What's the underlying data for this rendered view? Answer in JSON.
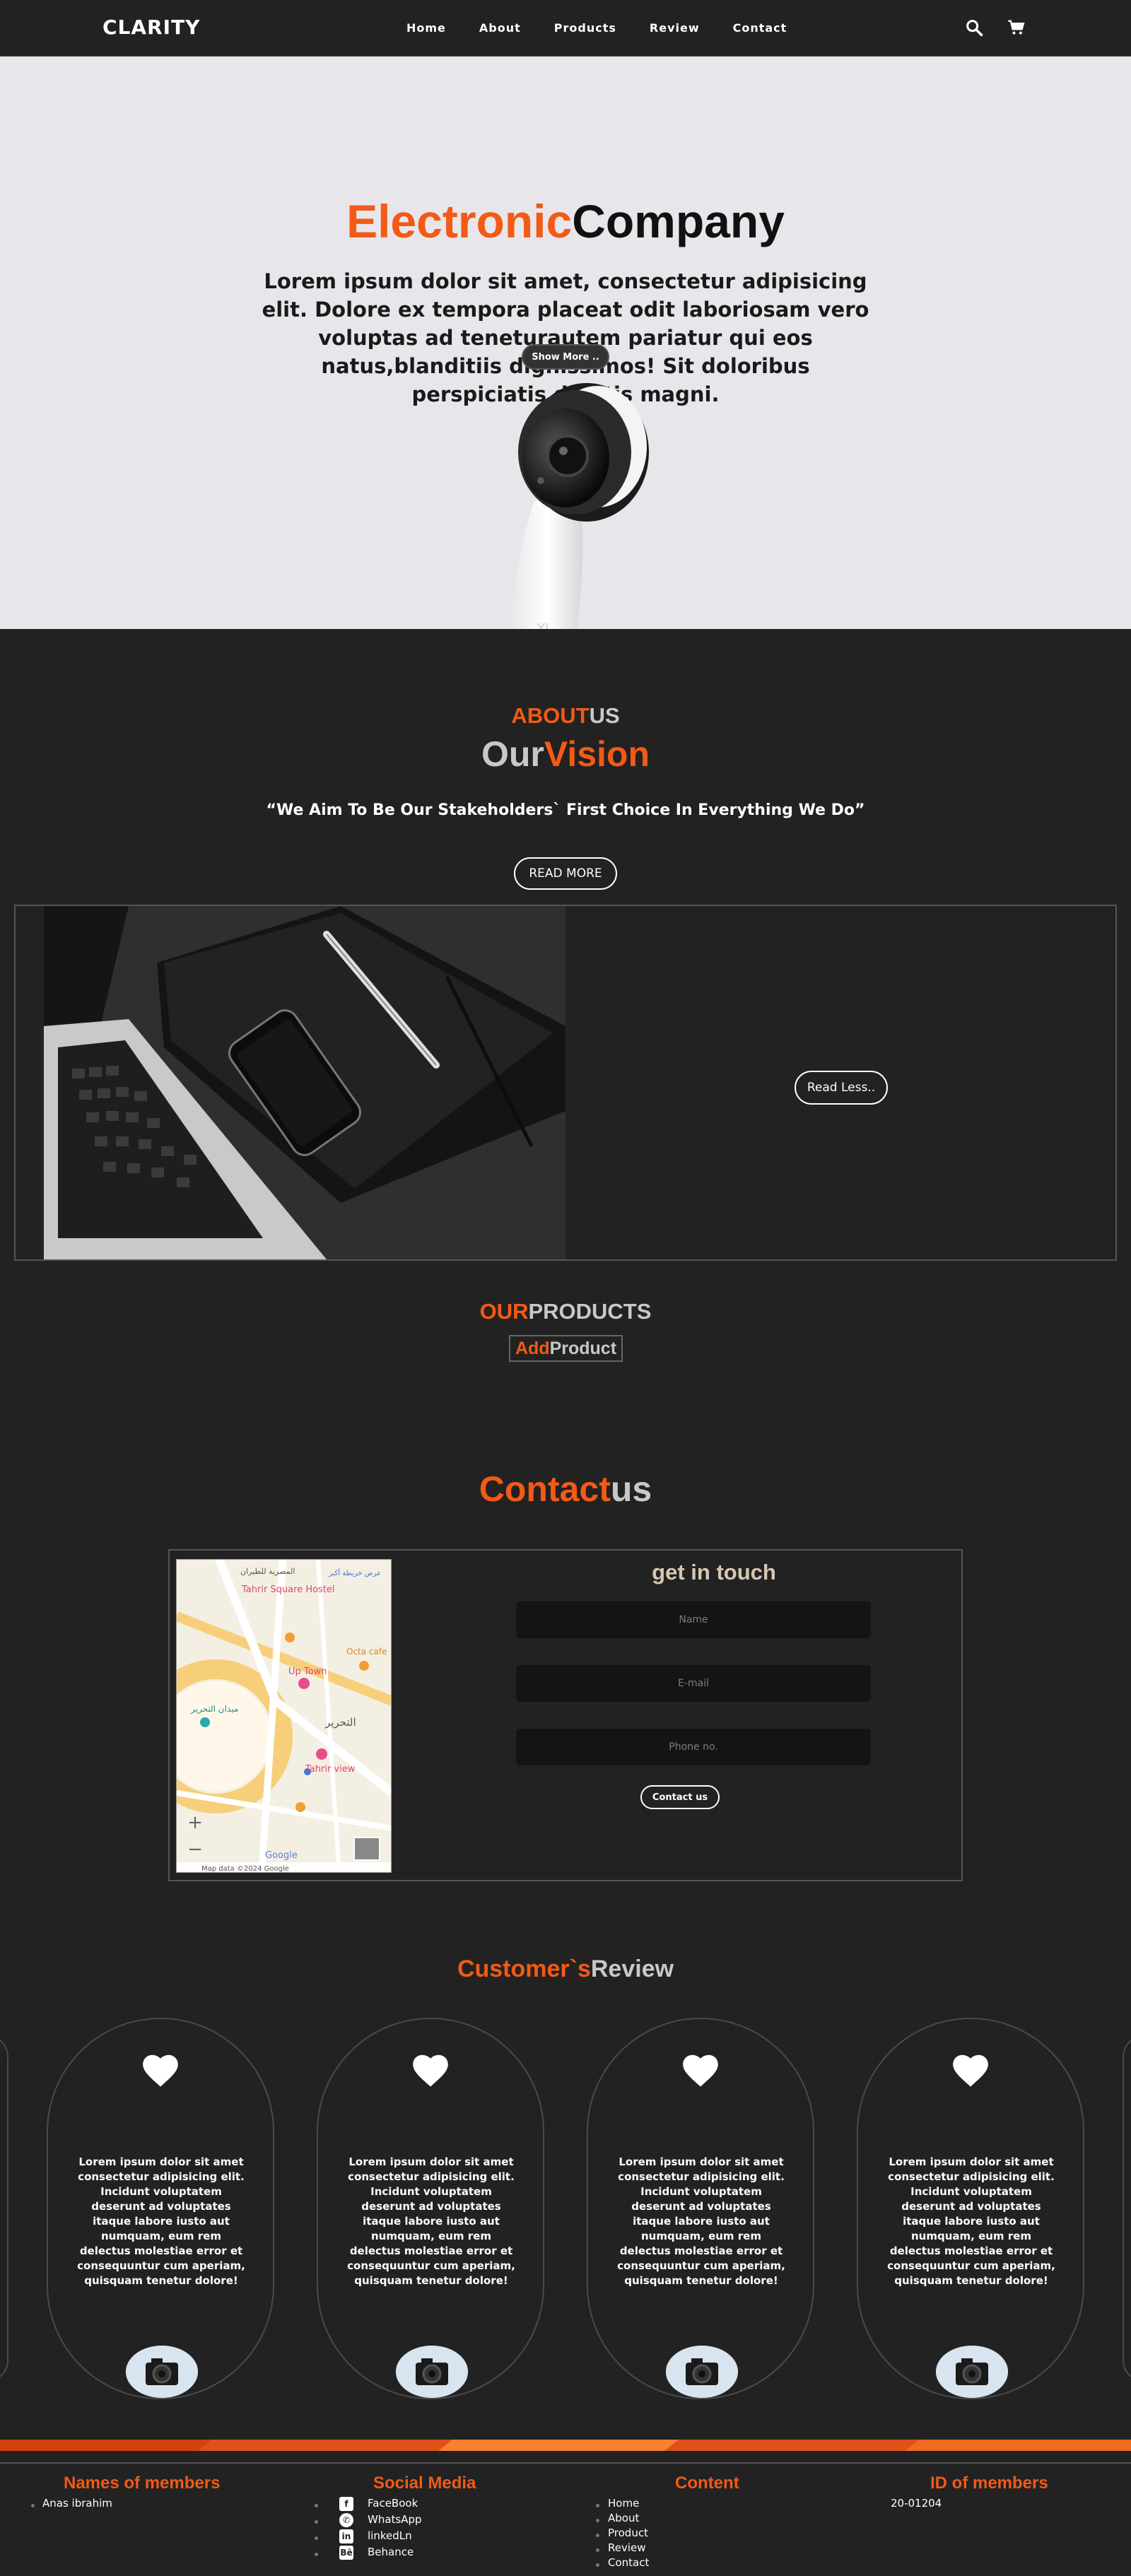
{
  "nav": {
    "brand": "CLARITY",
    "links": [
      "Home",
      "About",
      "Products",
      "Review",
      "Contact"
    ]
  },
  "hero": {
    "title_accent": "Electronic",
    "title_rest": "Company",
    "text": "Lorem ipsum dolor sit amet, consectetur adipisicing elit. Dolore ex tempora placeat odit laboriosam vero voluptas ad teneturautem pariatur qui eos natus,blanditiis dignissimos! Sit doloribus perspiciatis debitis magni.",
    "button": "Show More .."
  },
  "about": {
    "label_accent": "ABOUT",
    "label_rest": "US",
    "title_part1": "Our",
    "title_part2": "Vision",
    "quote": "“We Aim To Be Our Stakeholders` First Choice In Everything We Do”",
    "read_more": "READ MORE",
    "read_less": "Read Less.."
  },
  "products": {
    "label_accent": "OUR",
    "label_rest": "PRODUCTS",
    "add_accent": "Add",
    "add_rest": "Product"
  },
  "contact": {
    "title_accent": "Contact",
    "title_rest": "us",
    "heading": "get in touch",
    "name_placeholder": "Name",
    "email_placeholder": "E-mail",
    "phone_placeholder": "Phone no.",
    "button": "Contact us",
    "map": {
      "labels": [
        "Tahrir Square Hostel",
        "Up Town",
        "Tahrir view",
        "Octa cafe",
        "ميدان التحرير",
        "التحرير",
        "عرض خريطة أكبر",
        "المصرية للطيران"
      ],
      "attribution": "Map data ©2024 Google",
      "google": "Google",
      "zoom_in": "+",
      "zoom_out": "−"
    }
  },
  "reviews": {
    "title_accent": "Customer`s",
    "title_rest": "Review",
    "cards": [
      {
        "text": "Lorem ipsum dolor sit amet consectetur adipisicing elit. Incidunt voluptatem deserunt ad voluptates itaque labore iusto aut numquam, eum rem delectus molestiae error et consequuntur cum aperiam, quisquam tenetur dolore!"
      },
      {
        "text": "Lorem ipsum dolor sit amet consectetur adipisicing elit. Incidunt voluptatem deserunt ad voluptates itaque labore iusto aut numquam, eum rem delectus molestiae error et consequuntur cum aperiam, quisquam tenetur dolore!"
      },
      {
        "text": "Lorem ipsum dolor sit amet consectetur adipisicing elit. Incidunt voluptatem deserunt ad voluptates itaque labore iusto aut numquam, eum rem delectus molestiae error et consequuntur cum aperiam, quisquam tenetur dolore!"
      },
      {
        "text": "Lorem ipsum dolor sit amet consectetur adipisicing elit. Incidunt voluptatem deserunt ad voluptates itaque labore iusto aut numquam, eum rem delectus molestiae error et consequuntur cum aperiam, quisquam tenetur dolore!"
      }
    ]
  },
  "footer": {
    "members_title": "Names of members",
    "members": [
      "Anas ibrahim"
    ],
    "social_title": "Social Media",
    "social": [
      {
        "icon": "facebook-icon",
        "label": "FaceBook"
      },
      {
        "icon": "whatsapp-icon",
        "label": "WhatsApp"
      },
      {
        "icon": "linkedin-icon",
        "label": "linkedLn"
      },
      {
        "icon": "behance-icon",
        "label": "Behance"
      }
    ],
    "content_title": "Content",
    "content": [
      "Home",
      "About",
      "Product",
      "Review",
      "Contact"
    ],
    "id_title": "ID of members",
    "ids": [
      "20-01204"
    ]
  },
  "colors": {
    "accent": "#f25a16",
    "background": "#222222",
    "hero_bg": "#e8e6ea"
  }
}
